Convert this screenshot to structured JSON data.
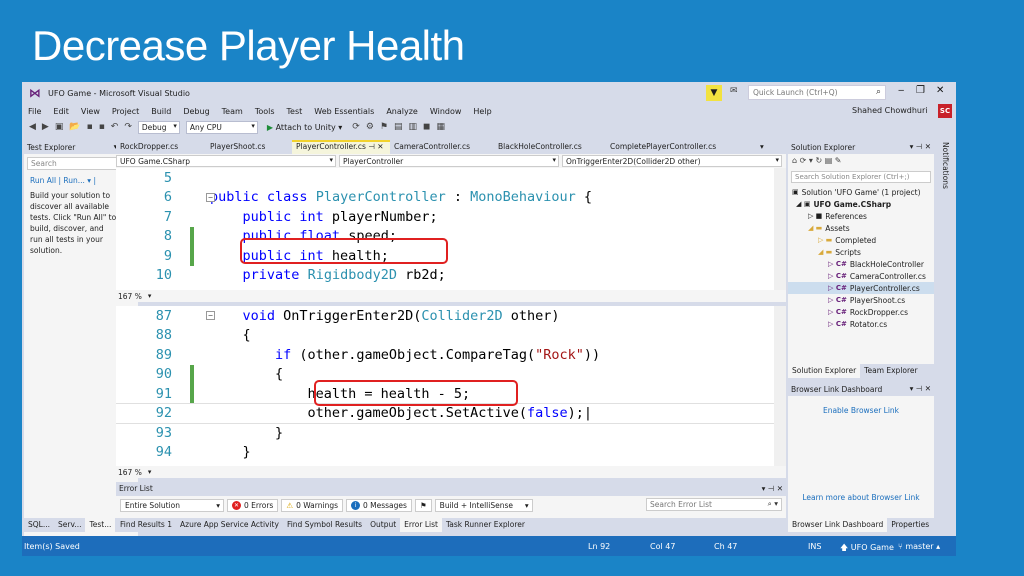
{
  "slide": {
    "title": "Decrease Player Health"
  },
  "window": {
    "title": "UFO Game - Microsoft Visual Studio",
    "quick_launch_placeholder": "Quick Launch (Ctrl+Q)",
    "user": "Shahed Chowdhuri",
    "user_badge": "SC"
  },
  "menu": [
    "File",
    "Edit",
    "View",
    "Project",
    "Build",
    "Debug",
    "Team",
    "Tools",
    "Test",
    "Web Essentials",
    "Analyze",
    "Window",
    "Help"
  ],
  "toolbar": {
    "config": "Debug",
    "platform": "Any CPU",
    "attach": "Attach to Unity"
  },
  "test_explorer": {
    "title": "Test Explorer",
    "search_placeholder": "Search",
    "run_all": "Run All",
    "run": "Run...",
    "description": "Build your solution to discover all available tests. Click \"Run All\" to build, discover, and run all tests in your solution."
  },
  "left_bottom_tabs": [
    "SQL...",
    "Serv...",
    "Test..."
  ],
  "editor": {
    "tabs": [
      "RockDropper.cs",
      "PlayerShoot.cs",
      "PlayerController.cs",
      "CameraController.cs",
      "BlackHoleController.cs",
      "CompletePlayerController.cs"
    ],
    "active_tab": "PlayerController.cs",
    "nav": {
      "project": "UFO Game.CSharp",
      "class": "PlayerController",
      "member": "OnTriggerEnter2D(Collider2D other)"
    },
    "zoom": "167 %",
    "top_lines": [
      {
        "n": "5",
        "code": ""
      },
      {
        "n": "6",
        "code": "public class PlayerController : MonoBehaviour {"
      },
      {
        "n": "7",
        "code": "    public int playerNumber;"
      },
      {
        "n": "8",
        "code": "    public float speed;"
      },
      {
        "n": "9",
        "code": "    public int health;"
      },
      {
        "n": "10",
        "code": "    private Rigidbody2D rb2d;"
      }
    ],
    "bottom_lines": [
      {
        "n": "87",
        "code": "    void OnTriggerEnter2D(Collider2D other)"
      },
      {
        "n": "88",
        "code": "    {"
      },
      {
        "n": "89",
        "code": "        if (other.gameObject.CompareTag(\"Rock\"))"
      },
      {
        "n": "90",
        "code": "        {"
      },
      {
        "n": "91",
        "code": "            health = health - 5;"
      },
      {
        "n": "92",
        "code": "            other.gameObject.SetActive(false);"
      },
      {
        "n": "93",
        "code": "        }"
      },
      {
        "n": "94",
        "code": "    }"
      }
    ]
  },
  "error_list": {
    "title": "Error List",
    "scope": "Entire Solution",
    "errors": "0 Errors",
    "warnings": "0 Warnings",
    "messages": "0 Messages",
    "build": "Build + IntelliSense",
    "search_placeholder": "Search Error List"
  },
  "bottom_tabs": [
    "Find Results 1",
    "Azure App Service Activity",
    "Find Symbol Results",
    "Output",
    "Error List",
    "Task Runner Explorer"
  ],
  "solution_explorer": {
    "title": "Solution Explorer",
    "search_placeholder": "Search Solution Explorer (Ctrl+;)",
    "items": [
      "Solution 'UFO Game' (1 project)",
      "UFO Game.CSharp",
      "References",
      "Assets",
      "Completed",
      "Scripts",
      "BlackHoleController",
      "CameraController.cs",
      "PlayerController.cs",
      "PlayerShoot.cs",
      "RockDropper.cs",
      "Rotator.cs"
    ]
  },
  "right_tabs": [
    "Solution Explorer",
    "Team Explorer"
  ],
  "browser_link": {
    "title": "Browser Link Dashboard",
    "enable": "Enable Browser Link",
    "learn": "Learn more about Browser Link"
  },
  "right_bottom_tabs": [
    "Browser Link Dashboard",
    "Properties"
  ],
  "notifications": "Notifications",
  "status": {
    "left": "Item(s) Saved",
    "ln": "Ln 92",
    "col": "Col 47",
    "ch": "Ch 47",
    "ins": "INS",
    "project": "UFO Game",
    "branch": "master"
  }
}
